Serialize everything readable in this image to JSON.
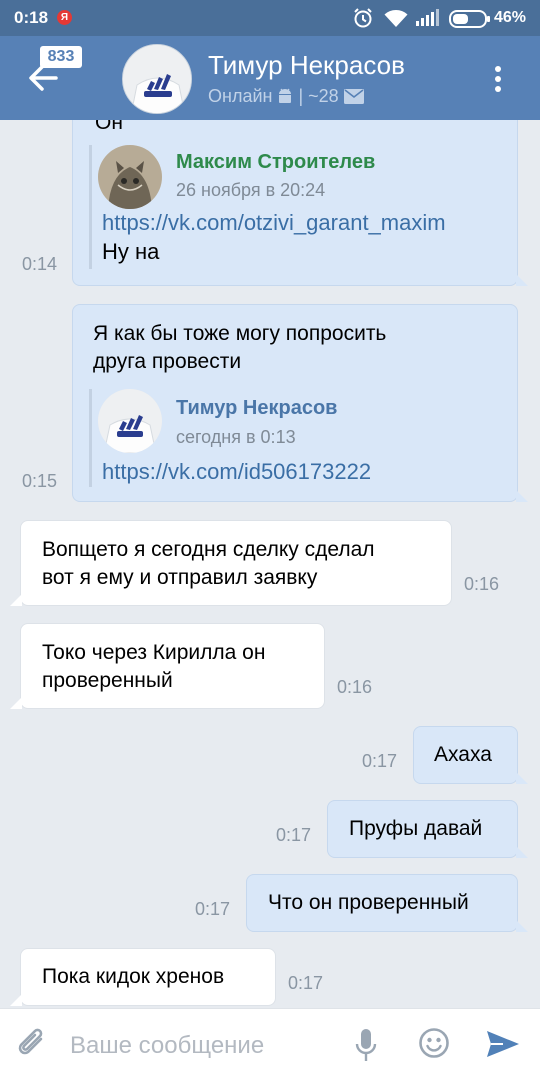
{
  "status_bar": {
    "time": "0:18",
    "notif_letter": "Я",
    "battery": "46%"
  },
  "header": {
    "unread": "833",
    "name": "Тимур Некрасов",
    "status_online": "Онлайн",
    "status_sep": "|",
    "status_more": "~28"
  },
  "messages": [
    {
      "top_text": "Он",
      "quote_name": "Максим Строителев",
      "quote_date": "26 ноября в 20:24",
      "quote_link": "https://vk.com/otzivi_garant_maxim",
      "quote_line": "Ну на",
      "time": "0:14"
    },
    {
      "text_1": "Я как бы тоже могу попросить",
      "text_2": "друга провести",
      "quote_name": "Тимур Некрасов",
      "quote_date": "сегодня в 0:13",
      "quote_link": "https://vk.com/id506173222",
      "time": "0:15"
    },
    {
      "text_1": "Вопщето я сегодня сделку сделал",
      "text_2": "вот я ему и отправил заявку",
      "time": "0:16"
    },
    {
      "text_1": "Токо через Кирилла он",
      "text_2": "проверенный",
      "time": "0:16"
    },
    {
      "text": "Ахаха",
      "time": "0:17"
    },
    {
      "text": "Пруфы давай",
      "time": "0:17"
    },
    {
      "text": "Что он проверенный",
      "time": "0:17"
    },
    {
      "text": "Пока кидок хренов",
      "time": "0:17"
    }
  ],
  "composer": {
    "placeholder": "Ваше сообщение"
  },
  "colors": {
    "header": "#5781b6",
    "status_bar": "#4a6f99",
    "bubble_out": "#d9e7f8",
    "bubble_in": "#ffffff",
    "link": "#3a6ea5",
    "send": "#5181b8"
  },
  "icons": [
    "back-arrow-icon",
    "android-icon",
    "mail-icon",
    "menu-icon",
    "attach-icon",
    "mic-icon",
    "emoji-icon",
    "send-icon"
  ]
}
